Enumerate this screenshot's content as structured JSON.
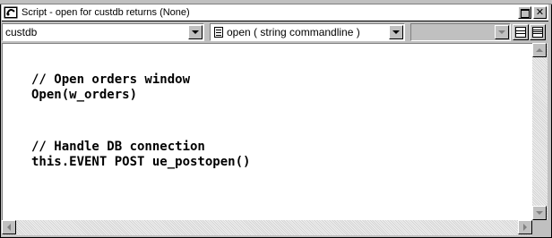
{
  "window": {
    "title": "Script - open for custdb returns (None)",
    "minimize_icon": "maximize-icon",
    "close_glyph": "✕"
  },
  "toolbar": {
    "object_select": "custdb",
    "event_select": "open ( string commandline )",
    "third_select": "",
    "event_icon": "document-icon"
  },
  "editor": {
    "lines": [
      "// Open orders window",
      "Open(w_orders)",
      "",
      "",
      "// Handle DB connection",
      "this.EVENT POST ue_postopen()"
    ]
  },
  "colors": {
    "chrome": "#c0c0c0",
    "editor_bg": "#ffffff",
    "text": "#000000"
  }
}
